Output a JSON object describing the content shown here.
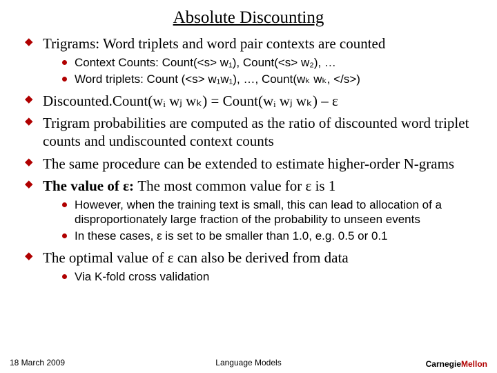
{
  "title": "Absolute Discounting",
  "bullets": {
    "b1": "Trigrams:  Word triplets and word pair contexts are counted",
    "b1a": "Context Counts: Count(<s> w₁), Count(<s> w₂), …",
    "b1b": "Word triplets:  Count (<s> w₁w₁), …, Count(wₖ wₖ, </s>)",
    "b2": "Discounted.Count(wᵢ wⱼ wₖ) = Count(wᵢ wⱼ wₖ) – ε",
    "b3": "Trigram probabilities are computed as the ratio of discounted word triplet counts and undiscounted context counts",
    "b4": "The same procedure can be extended to estimate higher-order N-grams",
    "b5_prefix": "The value of ε:",
    "b5_rest": " The most common value for ε is 1",
    "b5a": "However, when the training text is small, this can lead to allocation of a disproportionately large fraction of the probability to unseen events",
    "b5b": "In these cases, ε is set to be smaller than 1.0, e.g. 0.5 or 0.1",
    "b6": "The optimal value of ε can also be derived from data",
    "b6a": "Via K-fold cross validation"
  },
  "footer": {
    "date": "18 March 2009",
    "center": "Language Models",
    "logo1": "Carnegie",
    "logo2": "Mellon"
  }
}
